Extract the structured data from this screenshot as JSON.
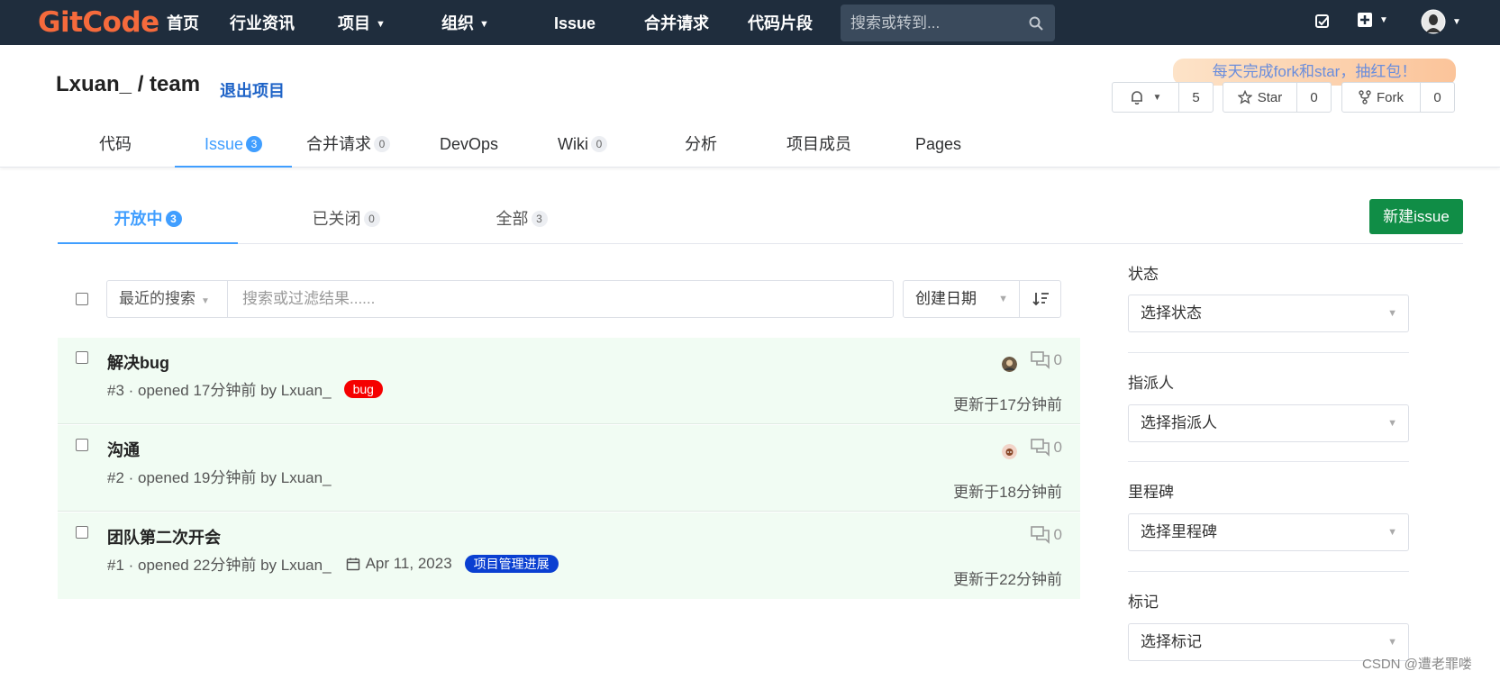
{
  "topnav": {
    "logo": "GitCode",
    "items": [
      "首页",
      "行业资讯",
      "项目",
      "组织",
      "Issue",
      "合并请求",
      "代码片段"
    ],
    "search_placeholder": "搜索或转到..."
  },
  "project": {
    "title": "Lxuan_ / team",
    "leave_label": "退出项目",
    "banner": "每天完成fork和star，抽红包！",
    "watch_count": "5",
    "star_label": "Star",
    "star_count": "0",
    "fork_label": "Fork",
    "fork_count": "0"
  },
  "tabs": [
    {
      "label": "代码",
      "count": ""
    },
    {
      "label": "Issue",
      "count": "3"
    },
    {
      "label": "合并请求",
      "count": "0"
    },
    {
      "label": "DevOps",
      "count": ""
    },
    {
      "label": "Wiki",
      "count": "0"
    },
    {
      "label": "分析",
      "count": ""
    },
    {
      "label": "项目成员",
      "count": ""
    },
    {
      "label": "Pages",
      "count": ""
    }
  ],
  "subtabs": [
    {
      "label": "开放中",
      "count": "3"
    },
    {
      "label": "已关闭",
      "count": "0"
    },
    {
      "label": "全部",
      "count": "3"
    }
  ],
  "new_issue_label": "新建issue",
  "filter": {
    "recent_label": "最近的搜索",
    "placeholder": "搜索或过滤结果......",
    "sort_label": "创建日期"
  },
  "issues": [
    {
      "title": "解决bug",
      "meta": "#3 · opened 17分钟前 by Lxuan_",
      "label": "bug",
      "label_color": "#f50000",
      "due": "",
      "comments": "0",
      "updated": "更新于17分钟前"
    },
    {
      "title": "沟通",
      "meta": "#2 · opened 19分钟前 by Lxuan_",
      "label": "",
      "label_color": "",
      "due": "",
      "comments": "0",
      "updated": "更新于18分钟前"
    },
    {
      "title": "团队第二次开会",
      "meta": "#1 · opened 22分钟前 by Lxuan_",
      "label": "项目管理进展",
      "label_color": "#0a3fd1",
      "due": "Apr 11, 2023",
      "comments": "0",
      "updated": "更新于22分钟前"
    }
  ],
  "sidebar": [
    {
      "label": "状态",
      "select": "选择状态"
    },
    {
      "label": "指派人",
      "select": "选择指派人"
    },
    {
      "label": "里程碑",
      "select": "选择里程碑"
    },
    {
      "label": "标记",
      "select": "选择标记"
    }
  ],
  "watermark": "CSDN @遭老罪喽"
}
